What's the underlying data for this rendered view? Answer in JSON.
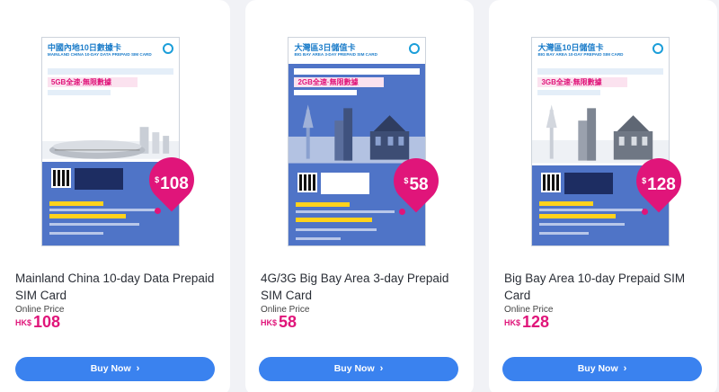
{
  "products": [
    {
      "title": "Mainland China 10-day Data Prepaid SIM Card",
      "price_label": "Online Price",
      "currency": "HK$",
      "price": "108",
      "button": "Buy Now",
      "package": {
        "heading": "中國內地10日數據卡",
        "subheading": "MAINLAND CHINA 10-DAY DATA PREPAID SIM CARD",
        "highlight": "5GB全速·無限數據",
        "badge_price": "108",
        "theme": "white"
      }
    },
    {
      "title": "4G/3G Big Bay Area 3-day Prepaid SIM Card",
      "price_label": "Online Price",
      "currency": "HK$",
      "price": "58",
      "button": "Buy Now",
      "package": {
        "heading": "大灣區3日儲值卡",
        "subheading": "BIG BAY AREA 3-DAY PREPAID SIM CARD",
        "highlight": "2GB全速·無限數據",
        "badge_price": "58",
        "theme": "blue"
      }
    },
    {
      "title": "Big Bay Area 10-day Prepaid SIM Card",
      "price_label": "Online Price",
      "currency": "HK$",
      "price": "128",
      "button": "Buy Now",
      "package": {
        "heading": "大灣區10日儲值卡",
        "subheading": "BIG BAY AREA 10-DAY PREPAID SIM CARD",
        "highlight": "3GB全速·無限數據",
        "badge_price": "128",
        "theme": "white"
      }
    }
  ],
  "icons": {
    "button_chevron": "chevron-right-icon",
    "price_pin": "location-pin-icon"
  },
  "colors": {
    "accent": "#e0157a",
    "button": "#3a82ef",
    "card_blue": "#4f74c7"
  }
}
